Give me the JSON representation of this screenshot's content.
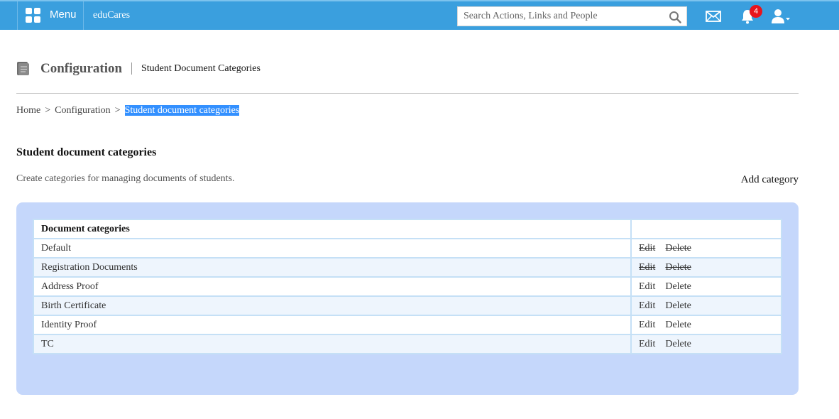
{
  "header": {
    "menu_label": "Menu",
    "brand": "eduCares",
    "search_placeholder": "Search Actions, Links and People",
    "notification_count": "4",
    "icons": [
      "grid-icon",
      "search-icon",
      "mail-icon",
      "bell-icon",
      "user-icon"
    ],
    "bar_color": "#3a9fde"
  },
  "page": {
    "title": "Configuration",
    "subtitle": "Student Document Categories"
  },
  "breadcrumb": {
    "items": [
      "Home",
      "Configuration"
    ],
    "separator": ">",
    "current": "Student document categories"
  },
  "section": {
    "title": "Student document categories",
    "description": "Create categories for managing documents of students.",
    "add_label": "Add category"
  },
  "table": {
    "header": "Document categories",
    "edit_label": "Edit",
    "delete_label": "Delete",
    "rows": [
      {
        "name": "Default",
        "disabled": true
      },
      {
        "name": "Registration Documents",
        "disabled": true
      },
      {
        "name": "Address Proof",
        "disabled": false
      },
      {
        "name": "Birth Certificate",
        "disabled": false
      },
      {
        "name": "Identity Proof",
        "disabled": false
      },
      {
        "name": "TC",
        "disabled": false
      }
    ],
    "panel_color": "#c5d7fb"
  }
}
